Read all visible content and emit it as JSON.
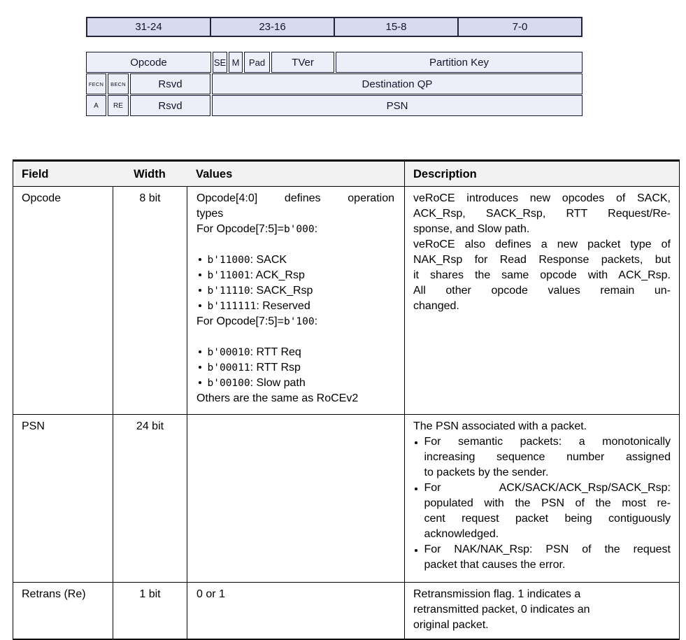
{
  "bit_diagram": {
    "bits_header": [
      "31-24",
      "23-16",
      "15-8",
      "7-0"
    ],
    "row1": {
      "opcode": "Opcode",
      "se": "SE",
      "m": "M",
      "pad": "Pad",
      "tver": "TVer",
      "partition_key": "Partition Key"
    },
    "row2": {
      "fecn": "FECN",
      "becn": "BECN",
      "rsvd": "Rsvd",
      "destination_qp": "Destination QP"
    },
    "row3": {
      "a": "A",
      "re": "RE",
      "rsvd": "Rsvd",
      "psn": "PSN"
    }
  },
  "colors": {
    "bits_header_bg": "#d8daf0",
    "packet_cell_bg": "#edeff8",
    "diagram_border": "#23233c",
    "table_header_bg": "#f2f2f2",
    "table_border": "#000000",
    "text": "#000000"
  },
  "table": {
    "headers": {
      "field": "Field",
      "width": "Width",
      "values": "Values",
      "description": "Description"
    },
    "rows": [
      {
        "field": "Opcode",
        "width": "8 bit",
        "values": {
          "intro_line1": "Opcode[4:0] defines operation",
          "intro_line2": "types",
          "for1": {
            "pre": "For Opcode[7:5]=",
            "code": "b'000",
            "post": ":"
          },
          "group1": [
            {
              "code": "b'11000",
              "rest": ": SACK"
            },
            {
              "code": "b'11001",
              "rest": ": ACK_Rsp"
            },
            {
              "code": "b'11110",
              "rest": ": SACK_Rsp"
            },
            {
              "code": "b'111111",
              "rest": ": Reserved"
            }
          ],
          "for2": {
            "pre": "For Opcode[7:5]=",
            "code": "b'100",
            "post": ":"
          },
          "group2": [
            {
              "code": "b'00010",
              "rest": ": RTT Req"
            },
            {
              "code": "b'00011",
              "rest": ": RTT Rsp"
            },
            {
              "code": "b'00100",
              "rest": ": Slow path"
            }
          ],
          "footer": "Others are the same as RoCEv2"
        },
        "description": {
          "lines": [
            "veRoCE introduces new opcodes of SACK,",
            "ACK_Rsp, SACK_Rsp, RTT Request/Re-",
            "sponse, and Slow path.",
            "veRoCE also defines a new packet type of",
            "NAK_Rsp for Read Response packets, but",
            "it shares the same opcode with ACK_Rsp.",
            "All other opcode values remain un-",
            "changed."
          ]
        }
      },
      {
        "field": "PSN",
        "width": "24 bit",
        "values": {
          "text": ""
        },
        "description": {
          "intro": "The PSN associated with a packet.",
          "bullets": [
            {
              "lines": [
                "For semantic packets: a monotonically",
                "increasing sequence number assigned",
                "to packets by the sender."
              ]
            },
            {
              "lines": [
                "For ACK/SACK/ACK_Rsp/SACK_Rsp:",
                "populated with the PSN of the most re-",
                "cent request packet being contiguously",
                "acknowledged."
              ]
            },
            {
              "lines": [
                "For NAK/NAK_Rsp: PSN of the request",
                "packet that causes the error."
              ]
            }
          ]
        }
      },
      {
        "field": "Retrans (Re)",
        "width": "1 bit",
        "values": {
          "text": "0 or 1"
        },
        "description": {
          "lines": [
            "Retransmission flag. 1 indicates a",
            "retransmitted packet, 0 indicates an",
            "original packet."
          ]
        }
      }
    ]
  }
}
